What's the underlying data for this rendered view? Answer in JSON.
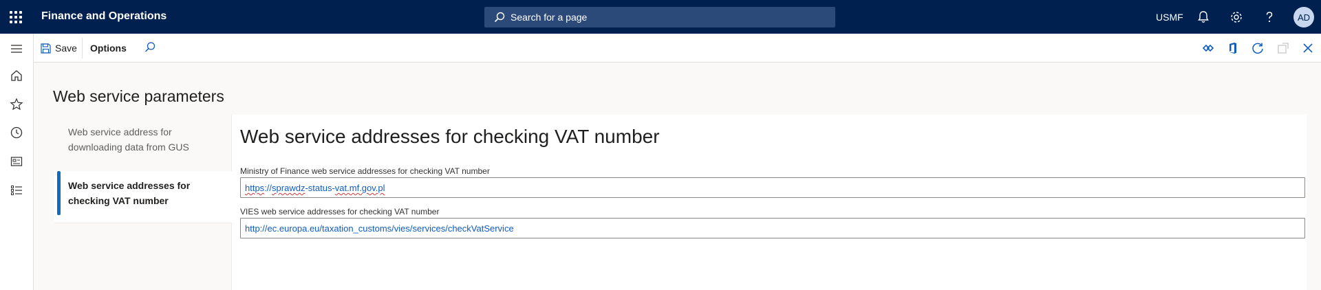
{
  "topbar": {
    "app_title": "Finance and Operations",
    "search_placeholder": "Search for a page",
    "company": "USMF",
    "user_initials": "AD"
  },
  "actionbar": {
    "save_label": "Save",
    "options_label": "Options"
  },
  "page": {
    "title": "Web service parameters"
  },
  "tabs": [
    {
      "label": "Web service address for downloading data from GUS",
      "active": false
    },
    {
      "label": "Web service addresses for checking VAT number",
      "active": true
    }
  ],
  "section": {
    "title": "Web service addresses for checking VAT number",
    "ministry_label": "Ministry of Finance web service addresses for checking VAT number",
    "ministry_value_parts": [
      "https",
      "://",
      "sprawdz",
      "-status-",
      "vat.mf.gov.pl"
    ],
    "vies_label": "VIES web service addresses for checking VAT number",
    "vies_value": "http://ec.europa.eu/taxation_customs/vies/services/checkVatService"
  },
  "colors": {
    "nav_background": "#002050",
    "accent": "#0f6cbd",
    "link": "#0f5cbf"
  }
}
